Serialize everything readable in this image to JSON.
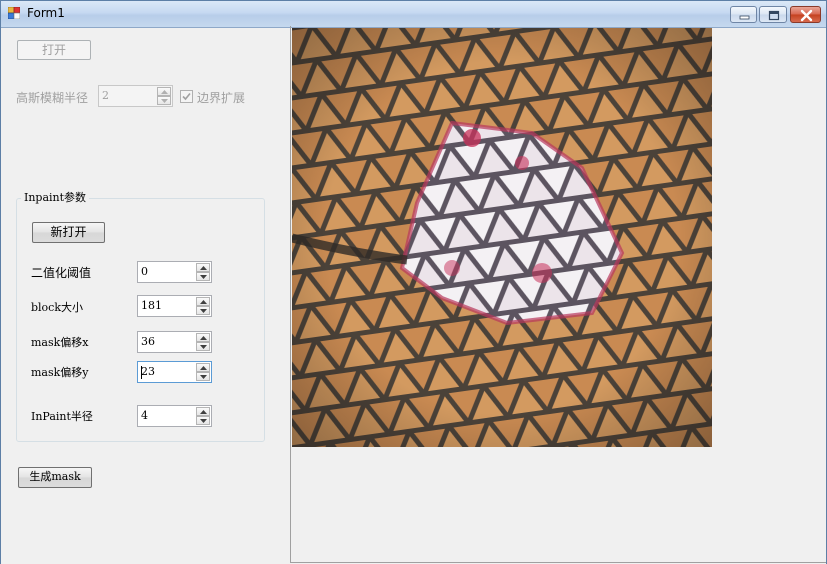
{
  "window": {
    "title": "Form1"
  },
  "top": {
    "open_button": "打开",
    "blur_label": "高斯模糊半径",
    "blur_value": "2",
    "border_checkbox_label": "边界扩展",
    "border_checked": true
  },
  "inpaint": {
    "group_title": "Inpaint参数",
    "reopen_button": "新打开",
    "threshold_label": "二值化阈值",
    "threshold_value": "0",
    "block_label": "block大小",
    "block_value": "181",
    "maskx_label": "mask偏移x",
    "maskx_value": "36",
    "masky_label": "mask偏移y",
    "masky_value": "23",
    "radius_label": "InPaint半径",
    "radius_value": "4"
  },
  "generate_button": "生成mask",
  "colors": {
    "title_bar": "#c6d9f1",
    "close_button": "#c4401f",
    "form_bg": "#f0f0f0",
    "photo_orange": "#c98a52"
  },
  "icons": [
    "app-icon",
    "minimize-icon",
    "maximize-icon",
    "close-icon",
    "spin-up-icon",
    "spin-down-icon",
    "checkmark-icon"
  ]
}
